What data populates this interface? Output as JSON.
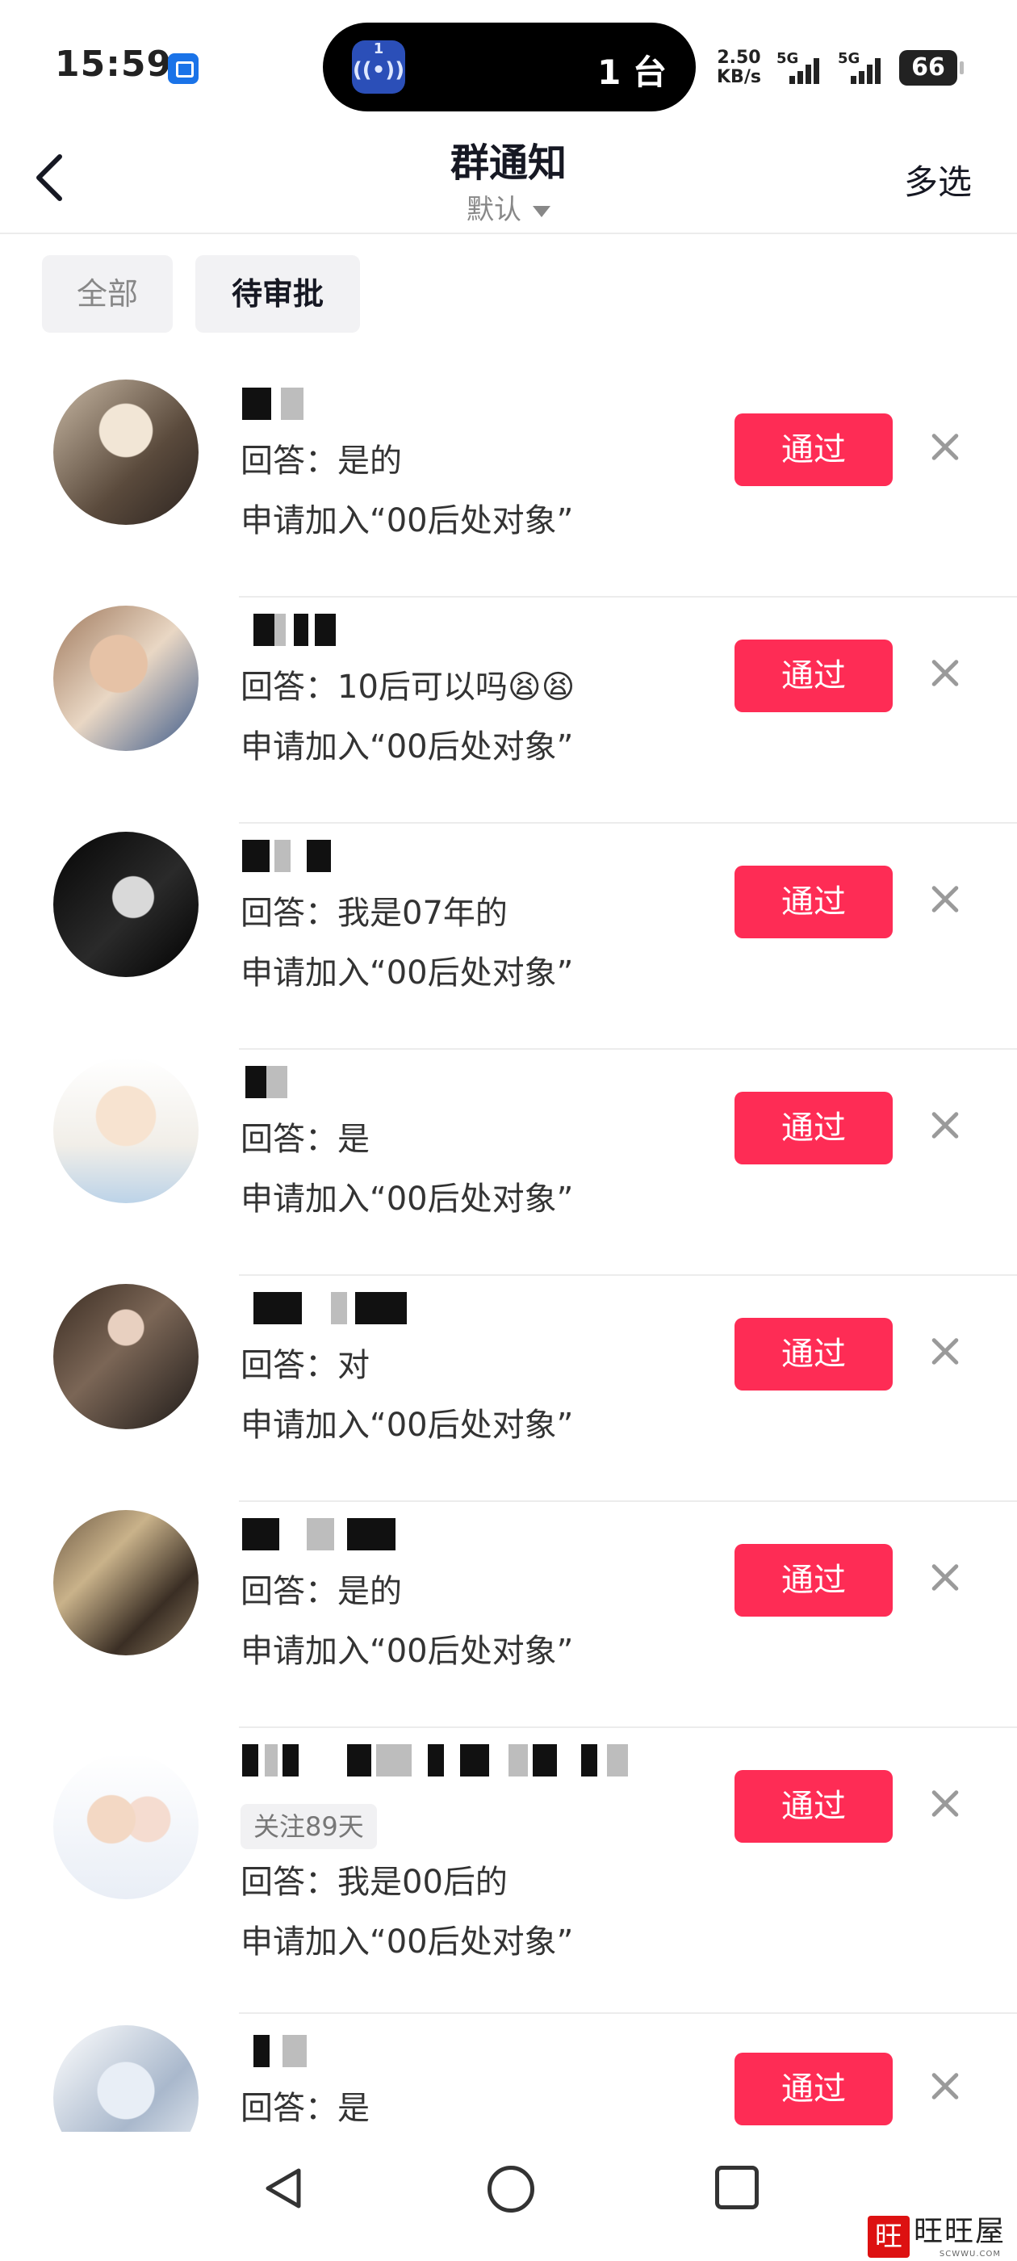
{
  "status_bar": {
    "time": "15:59",
    "island_badge": "1",
    "island_text": "1 台",
    "net_speed_value": "2.50",
    "net_speed_unit": "KB/s",
    "signal_1_label": "5G",
    "signal_2_label": "5G",
    "battery": "66"
  },
  "header": {
    "title": "群通知",
    "subtitle": "默认",
    "multi_select": "多选"
  },
  "tabs": [
    {
      "label": "全部",
      "active": false
    },
    {
      "label": "待审批",
      "active": true
    }
  ],
  "requests": [
    {
      "badge": "",
      "answer": "回答：是的",
      "apply": "申请加入“00后处对象”",
      "pass_label": "通过"
    },
    {
      "badge": "",
      "answer": "回答：10后可以吗😫😫",
      "apply": "申请加入“00后处对象”",
      "pass_label": "通过"
    },
    {
      "badge": "",
      "answer": "回答：我是07年的",
      "apply": "申请加入“00后处对象”",
      "pass_label": "通过"
    },
    {
      "badge": "",
      "answer": "回答：是",
      "apply": "申请加入“00后处对象”",
      "pass_label": "通过"
    },
    {
      "badge": "",
      "answer": "回答：对",
      "apply": "申请加入“00后处对象”",
      "pass_label": "通过"
    },
    {
      "badge": "",
      "answer": "回答：是的",
      "apply": "申请加入“00后处对象”",
      "pass_label": "通过"
    },
    {
      "badge": "关注89天",
      "answer": "回答：我是00后的",
      "apply": "申请加入“00后处对象”",
      "pass_label": "通过"
    },
    {
      "badge": "",
      "answer": "回答：是",
      "apply": "",
      "pass_label": "通过"
    }
  ],
  "watermark": {
    "seal": "旺",
    "text": "旺旺屋",
    "sub": "SCWWU.COM"
  },
  "colors": {
    "accent": "#fe2c55",
    "tab_bg": "#f2f2f4",
    "divider": "#ececec"
  },
  "icons": [
    "back-arrow-icon",
    "caret-down-icon",
    "close-icon",
    "nav-back-icon",
    "nav-home-icon",
    "nav-recent-icon"
  ]
}
